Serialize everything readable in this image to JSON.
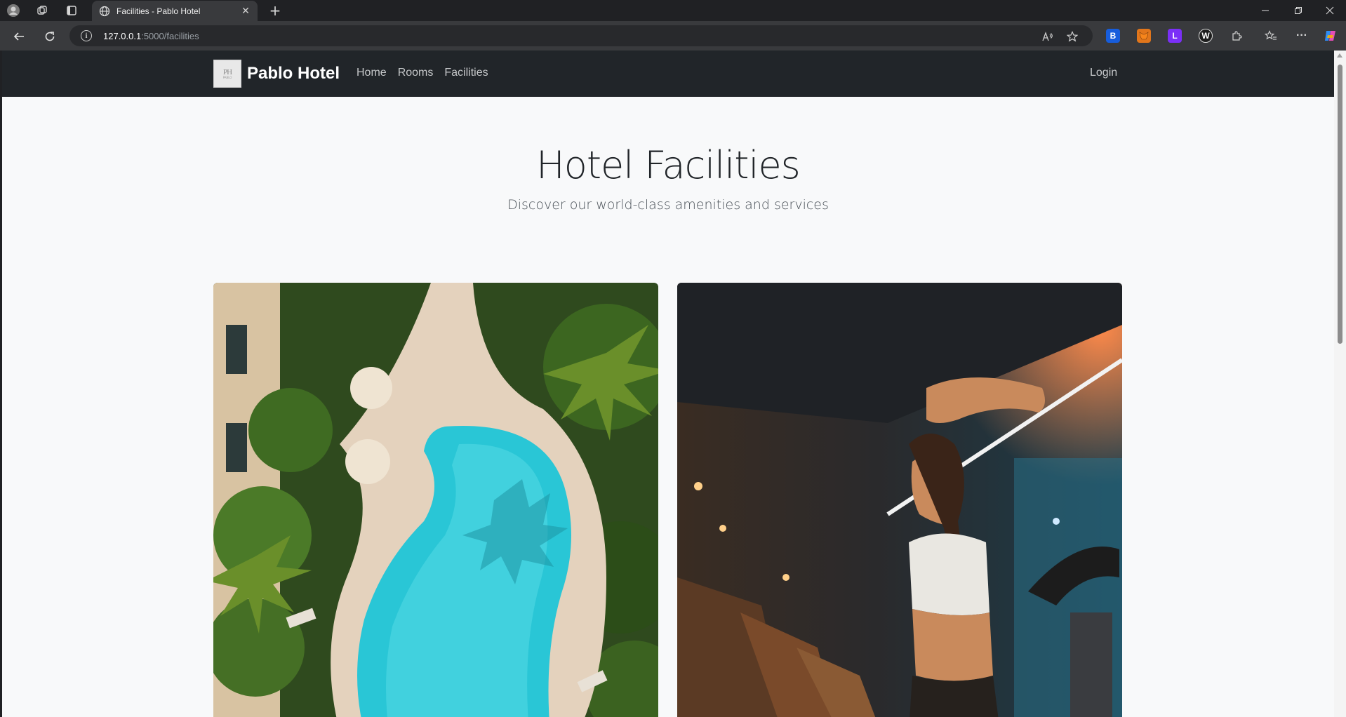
{
  "browser": {
    "tab_title": "Facilities - Pablo Hotel",
    "url_host": "127.0.0.1",
    "url_path": ":5000/facilities",
    "window_controls": [
      "minimize",
      "restore",
      "close"
    ],
    "extensions": [
      "bitwarden-icon",
      "metamask-icon",
      "extension-icon-purple",
      "extension-icon-dark"
    ]
  },
  "site": {
    "brand_name": "Pablo Hotel",
    "logo_mark": "PH",
    "logo_sub": "PABLO",
    "nav": [
      "Home",
      "Rooms",
      "Facilities"
    ],
    "login": "Login"
  },
  "hero": {
    "title": "Hotel Facilities",
    "subtitle": "Discover our world-class amenities and services"
  },
  "colors": {
    "navbar": "#212529",
    "page_bg": "#f8f9fa",
    "pool": "#29c6d6"
  },
  "cards": [
    {
      "subject": "pool-aerial-photo"
    },
    {
      "subject": "gym-photo"
    }
  ]
}
